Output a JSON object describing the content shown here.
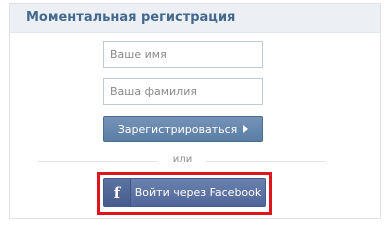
{
  "panel": {
    "title": "Моментальная регистрация"
  },
  "form": {
    "first_name_placeholder": "Ваше имя",
    "last_name_placeholder": "Ваша фамилия",
    "register_label": "Зарегистрироваться",
    "or_text": "или",
    "facebook_label": "Войти через Facebook",
    "facebook_icon_glyph": "f"
  },
  "colors": {
    "title": "#45688e",
    "header_bg": "#ecf0f4",
    "button_bg": "#6384ab",
    "facebook_bg": "#5b71a2",
    "highlight": "#e0141c"
  },
  "icons": {
    "register_arrow": "arrow-right-icon",
    "facebook": "facebook-icon"
  }
}
